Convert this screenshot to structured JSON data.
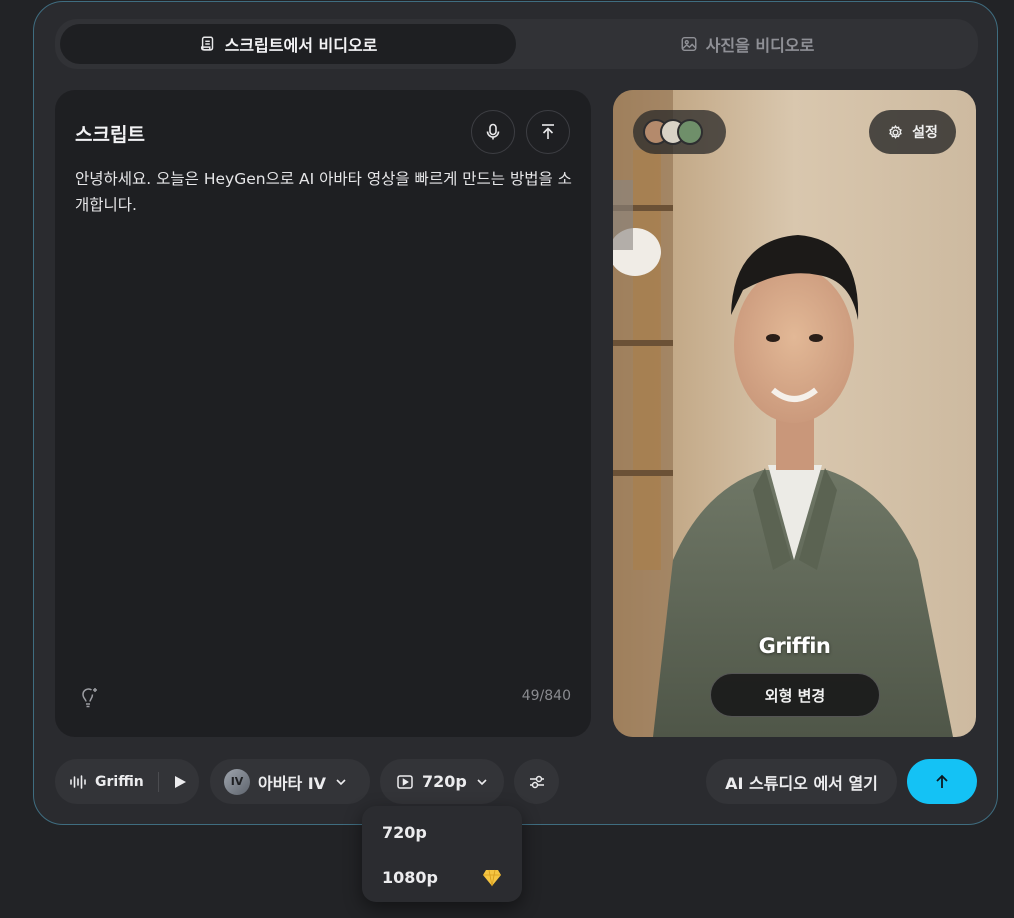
{
  "tabs": [
    {
      "label": "스크립트에서 비디오로",
      "icon": "script-icon",
      "active": true
    },
    {
      "label": "사진을 비디오로",
      "icon": "image-icon",
      "active": false
    }
  ],
  "script": {
    "title": "스크립트",
    "text": "안녕하세요. 오늘은 HeyGen으로 AI 아바타 영상을 빠르게 만드는 방법을 소개합니다.",
    "counter": "49/840"
  },
  "preview": {
    "settings_label": "설정",
    "avatar_name": "Griffin",
    "change_look_label": "외형 변경"
  },
  "toolbar": {
    "voice_name": "Griffin",
    "model_badge": "IV",
    "model_label": "아바타 IV",
    "resolution": "720p",
    "studio_label": "AI 스튜디오 에서 열기"
  },
  "resolution_menu": {
    "options": [
      "720p",
      "1080p"
    ]
  },
  "colors": {
    "accent": "#14c2f5",
    "frame_border": "#3f6d80",
    "panel_bg": "#1e1f22",
    "premium_gem": "#f5c542"
  }
}
